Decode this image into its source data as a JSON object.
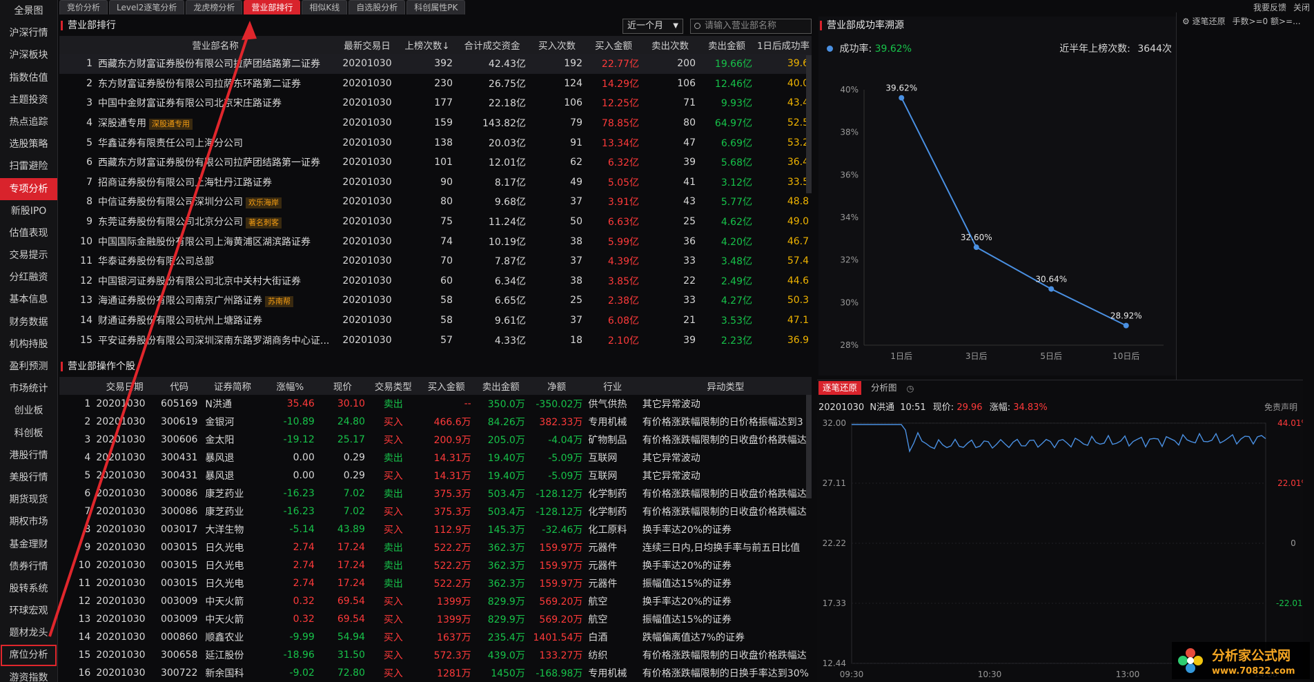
{
  "sidebar": [
    "全景图",
    "沪深行情",
    "沪深板块",
    "指数估值",
    "主题投资",
    "热点追踪",
    "选股策略",
    "扫雷避险",
    "专项分析",
    "新股IPO",
    "估值表现",
    "交易提示",
    "分红融资",
    "基本信息",
    "财务数据",
    "机构持股",
    "盈利预测",
    "市场统计",
    "创业板",
    "科创板",
    "港股行情",
    "美股行情",
    "期货现货",
    "期权市场",
    "基金理财",
    "债券行情",
    "股转系统",
    "环球宏观",
    "题材龙头",
    "席位分析",
    "游资指数"
  ],
  "sidebar_active": "专项分析",
  "sidebar_boxed": "席位分析",
  "tabs": [
    "竞价分析",
    "Level2逐笔分析",
    "龙虎榜分析",
    "营业部排行",
    "相似K线",
    "自选股分析",
    "科创属性PK"
  ],
  "tabs_active": "营业部排行",
  "topright": [
    "我要反馈",
    "关闭"
  ],
  "rank": {
    "title": "营业部排行",
    "period": "近一个月",
    "search_placeholder": "请输入营业部名称",
    "columns": [
      "",
      "营业部名称",
      "最新交易日",
      "上榜次数↓",
      "合计成交资金",
      "买入次数",
      "买入金额",
      "卖出次数",
      "卖出金额",
      "1日后成功率"
    ],
    "rows": [
      {
        "no": "1",
        "name": "西藏东方财富证券股份有限公司拉萨团结路第二证券",
        "tag": "",
        "date": "20201030",
        "count": "392",
        "total": "42.43亿",
        "buy_n": "192",
        "buy_amt": "22.77亿",
        "sell_n": "200",
        "sell_amt": "19.66亿",
        "rate": "39.6"
      },
      {
        "no": "2",
        "name": "东方财富证券股份有限公司拉萨东环路第二证券",
        "tag": "",
        "date": "20201030",
        "count": "230",
        "total": "26.75亿",
        "buy_n": "124",
        "buy_amt": "14.29亿",
        "sell_n": "106",
        "sell_amt": "12.46亿",
        "rate": "40.0"
      },
      {
        "no": "3",
        "name": "中国中金财富证券有限公司北京宋庄路证券",
        "tag": "",
        "date": "20201030",
        "count": "177",
        "total": "22.18亿",
        "buy_n": "106",
        "buy_amt": "12.25亿",
        "sell_n": "71",
        "sell_amt": "9.93亿",
        "rate": "43.4"
      },
      {
        "no": "4",
        "name": "深股通专用",
        "tag": "深股通专用",
        "date": "20201030",
        "count": "159",
        "total": "143.82亿",
        "buy_n": "79",
        "buy_amt": "78.85亿",
        "sell_n": "80",
        "sell_amt": "64.97亿",
        "rate": "52.5"
      },
      {
        "no": "5",
        "name": "华鑫证券有限责任公司上海分公司",
        "tag": "",
        "date": "20201030",
        "count": "138",
        "total": "20.03亿",
        "buy_n": "91",
        "buy_amt": "13.34亿",
        "sell_n": "47",
        "sell_amt": "6.69亿",
        "rate": "53.2"
      },
      {
        "no": "6",
        "name": "西藏东方财富证券股份有限公司拉萨团结路第一证券",
        "tag": "",
        "date": "20201030",
        "count": "101",
        "total": "12.01亿",
        "buy_n": "62",
        "buy_amt": "6.32亿",
        "sell_n": "39",
        "sell_amt": "5.68亿",
        "rate": "36.4"
      },
      {
        "no": "7",
        "name": "招商证券股份有限公司上海牡丹江路证券",
        "tag": "",
        "date": "20201030",
        "count": "90",
        "total": "8.17亿",
        "buy_n": "49",
        "buy_amt": "5.05亿",
        "sell_n": "41",
        "sell_amt": "3.12亿",
        "rate": "33.5"
      },
      {
        "no": "8",
        "name": "中信证券股份有限公司深圳分公司",
        "tag": "欢乐海岸",
        "date": "20201030",
        "count": "80",
        "total": "9.68亿",
        "buy_n": "37",
        "buy_amt": "3.91亿",
        "sell_n": "43",
        "sell_amt": "5.77亿",
        "rate": "48.8"
      },
      {
        "no": "9",
        "name": "东莞证券股份有限公司北京分公司",
        "tag": "著名刺客",
        "date": "20201030",
        "count": "75",
        "total": "11.24亿",
        "buy_n": "50",
        "buy_amt": "6.63亿",
        "sell_n": "25",
        "sell_amt": "4.62亿",
        "rate": "49.0"
      },
      {
        "no": "10",
        "name": "中国国际金融股份有限公司上海黄浦区湖滨路证券",
        "tag": "",
        "date": "20201030",
        "count": "74",
        "total": "10.19亿",
        "buy_n": "38",
        "buy_amt": "5.99亿",
        "sell_n": "36",
        "sell_amt": "4.20亿",
        "rate": "46.7"
      },
      {
        "no": "11",
        "name": "华泰证券股份有限公司总部",
        "tag": "",
        "date": "20201030",
        "count": "70",
        "total": "7.87亿",
        "buy_n": "37",
        "buy_amt": "4.39亿",
        "sell_n": "33",
        "sell_amt": "3.48亿",
        "rate": "57.4"
      },
      {
        "no": "12",
        "name": "中国银河证券股份有限公司北京中关村大街证券",
        "tag": "",
        "date": "20201030",
        "count": "60",
        "total": "6.34亿",
        "buy_n": "38",
        "buy_amt": "3.85亿",
        "sell_n": "22",
        "sell_amt": "2.49亿",
        "rate": "44.6"
      },
      {
        "no": "13",
        "name": "海通证券股份有限公司南京广州路证券",
        "tag": "苏南帮",
        "date": "20201030",
        "count": "58",
        "total": "6.65亿",
        "buy_n": "25",
        "buy_amt": "2.38亿",
        "sell_n": "33",
        "sell_amt": "4.27亿",
        "rate": "50.3"
      },
      {
        "no": "14",
        "name": "财通证券股份有限公司杭州上塘路证券",
        "tag": "",
        "date": "20201030",
        "count": "58",
        "total": "9.61亿",
        "buy_n": "37",
        "buy_amt": "6.08亿",
        "sell_n": "21",
        "sell_amt": "3.53亿",
        "rate": "47.1"
      },
      {
        "no": "15",
        "name": "平安证券股份有限公司深圳深南东路罗湖商务中心证...",
        "tag": "",
        "date": "20201030",
        "count": "57",
        "total": "4.33亿",
        "buy_n": "18",
        "buy_amt": "2.10亿",
        "sell_n": "39",
        "sell_amt": "2.23亿",
        "rate": "36.9"
      }
    ]
  },
  "ops": {
    "title": "营业部操作个股",
    "columns": [
      "",
      "交易日期",
      "代码",
      "证券简称",
      "涨幅%",
      "现价",
      "交易类型",
      "买入金额",
      "卖出金额",
      "净额",
      "行业",
      "异动类型"
    ],
    "rows": [
      {
        "no": "1",
        "date": "20201030",
        "code": "605169",
        "name": "N洪通",
        "chg": "35.46",
        "price": "30.10",
        "type": "卖出",
        "buy": "--",
        "sell": "350.0万",
        "net": "-350.02万",
        "ind": "供气供热",
        "reason": "其它异常波动"
      },
      {
        "no": "2",
        "date": "20201030",
        "code": "300619",
        "name": "金银河",
        "chg": "-10.89",
        "price": "24.80",
        "type": "买入",
        "buy": "466.6万",
        "sell": "84.26万",
        "net": "382.33万",
        "ind": "专用机械",
        "reason": "有价格涨跌幅限制的日价格振幅达到3"
      },
      {
        "no": "3",
        "date": "20201030",
        "code": "300606",
        "name": "金太阳",
        "chg": "-19.12",
        "price": "25.17",
        "type": "买入",
        "buy": "200.9万",
        "sell": "205.0万",
        "net": "-4.04万",
        "ind": "矿物制品",
        "reason": "有价格涨跌幅限制的日收盘价格跌幅达"
      },
      {
        "no": "4",
        "date": "20201030",
        "code": "300431",
        "name": "暴风退",
        "chg": "0.00",
        "price": "0.29",
        "type": "卖出",
        "buy": "14.31万",
        "sell": "19.40万",
        "net": "-5.09万",
        "ind": "互联网",
        "reason": "其它异常波动"
      },
      {
        "no": "5",
        "date": "20201030",
        "code": "300431",
        "name": "暴风退",
        "chg": "0.00",
        "price": "0.29",
        "type": "买入",
        "buy": "14.31万",
        "sell": "19.40万",
        "net": "-5.09万",
        "ind": "互联网",
        "reason": "其它异常波动"
      },
      {
        "no": "6",
        "date": "20201030",
        "code": "300086",
        "name": "康芝药业",
        "chg": "-16.23",
        "price": "7.02",
        "type": "卖出",
        "buy": "375.3万",
        "sell": "503.4万",
        "net": "-128.12万",
        "ind": "化学制药",
        "reason": "有价格涨跌幅限制的日收盘价格跌幅达"
      },
      {
        "no": "7",
        "date": "20201030",
        "code": "300086",
        "name": "康芝药业",
        "chg": "-16.23",
        "price": "7.02",
        "type": "买入",
        "buy": "375.3万",
        "sell": "503.4万",
        "net": "-128.12万",
        "ind": "化学制药",
        "reason": "有价格涨跌幅限制的日收盘价格跌幅达"
      },
      {
        "no": "8",
        "date": "20201030",
        "code": "003017",
        "name": "大洋生物",
        "chg": "-5.14",
        "price": "43.89",
        "type": "买入",
        "buy": "112.9万",
        "sell": "145.3万",
        "net": "-32.46万",
        "ind": "化工原料",
        "reason": "换手率达20%的证券"
      },
      {
        "no": "9",
        "date": "20201030",
        "code": "003015",
        "name": "日久光电",
        "chg": "2.74",
        "price": "17.24",
        "type": "卖出",
        "buy": "522.2万",
        "sell": "362.3万",
        "net": "159.97万",
        "ind": "元器件",
        "reason": "连续三日内,日均换手率与前五日比值"
      },
      {
        "no": "10",
        "date": "20201030",
        "code": "003015",
        "name": "日久光电",
        "chg": "2.74",
        "price": "17.24",
        "type": "卖出",
        "buy": "522.2万",
        "sell": "362.3万",
        "net": "159.97万",
        "ind": "元器件",
        "reason": "换手率达20%的证券"
      },
      {
        "no": "11",
        "date": "20201030",
        "code": "003015",
        "name": "日久光电",
        "chg": "2.74",
        "price": "17.24",
        "type": "卖出",
        "buy": "522.2万",
        "sell": "362.3万",
        "net": "159.97万",
        "ind": "元器件",
        "reason": "振幅值达15%的证券"
      },
      {
        "no": "12",
        "date": "20201030",
        "code": "003009",
        "name": "中天火箭",
        "chg": "0.32",
        "price": "69.54",
        "type": "买入",
        "buy": "1399万",
        "sell": "829.9万",
        "net": "569.20万",
        "ind": "航空",
        "reason": "换手率达20%的证券"
      },
      {
        "no": "13",
        "date": "20201030",
        "code": "003009",
        "name": "中天火箭",
        "chg": "0.32",
        "price": "69.54",
        "type": "买入",
        "buy": "1399万",
        "sell": "829.9万",
        "net": "569.20万",
        "ind": "航空",
        "reason": "振幅值达15%的证券"
      },
      {
        "no": "14",
        "date": "20201030",
        "code": "000860",
        "name": "顺鑫农业",
        "chg": "-9.99",
        "price": "54.94",
        "type": "买入",
        "buy": "1637万",
        "sell": "235.4万",
        "net": "1401.54万",
        "ind": "白酒",
        "reason": "跌幅偏离值达7%的证券"
      },
      {
        "no": "15",
        "date": "20201030",
        "code": "300658",
        "name": "延江股份",
        "chg": "-18.96",
        "price": "31.50",
        "type": "买入",
        "buy": "572.3万",
        "sell": "439.0万",
        "net": "133.27万",
        "ind": "纺织",
        "reason": "有价格涨跌幅限制的日收盘价格跌幅达"
      },
      {
        "no": "16",
        "date": "20201030",
        "code": "300722",
        "name": "新余国科",
        "chg": "-9.02",
        "price": "72.80",
        "type": "买入",
        "buy": "1281万",
        "sell": "1450万",
        "net": "-168.98万",
        "ind": "专用机械",
        "reason": "有价格涨跌幅限制的日换手率达到30%"
      }
    ]
  },
  "rate_panel": {
    "title": "营业部成功率溯源",
    "success_label": "成功率:",
    "success_value": "39.62%",
    "halfyear_label": "近半年上榜次数:",
    "halfyear_value": "3644次"
  },
  "chart_data": [
    {
      "type": "line",
      "categories": [
        "1日后",
        "3日后",
        "5日后",
        "10日后"
      ],
      "values": [
        39.62,
        32.6,
        30.64,
        28.92
      ],
      "labels": [
        "39.62%",
        "32.60%",
        "30.64%",
        "28.92%"
      ],
      "yticks": [
        "40%",
        "38%",
        "36%",
        "34%",
        "32%",
        "30%",
        "28%"
      ],
      "ylim": [
        28,
        40
      ]
    }
  ],
  "farright": {
    "label": "逐笔还原",
    "controls": "手数>=0 额>=..."
  },
  "intra": {
    "tabs": [
      "逐笔还原",
      "分析图"
    ],
    "info_date": "20201030",
    "info_name": "N洪通",
    "info_time": "10:51",
    "price_label": "现价:",
    "price_value": "29.96",
    "chg_label": "涨幅:",
    "chg_value": "34.83%",
    "disclaimer": "免责声明",
    "yticks_left": [
      "32.00",
      "27.11",
      "22.22",
      "17.33",
      "12.44"
    ],
    "yticks_right": [
      "44.01%",
      "22.01%",
      "0",
      "-22.01%",
      ""
    ],
    "xticks": [
      "09:30",
      "10:30",
      "13:00",
      "14:00"
    ]
  },
  "watermark": {
    "title": "分析家公式网",
    "url": "www.70822.com"
  },
  "colors": {
    "accent": "#d9232c",
    "up": "#ff3a3a",
    "down": "#17c34a",
    "line": "#4a90e2"
  }
}
